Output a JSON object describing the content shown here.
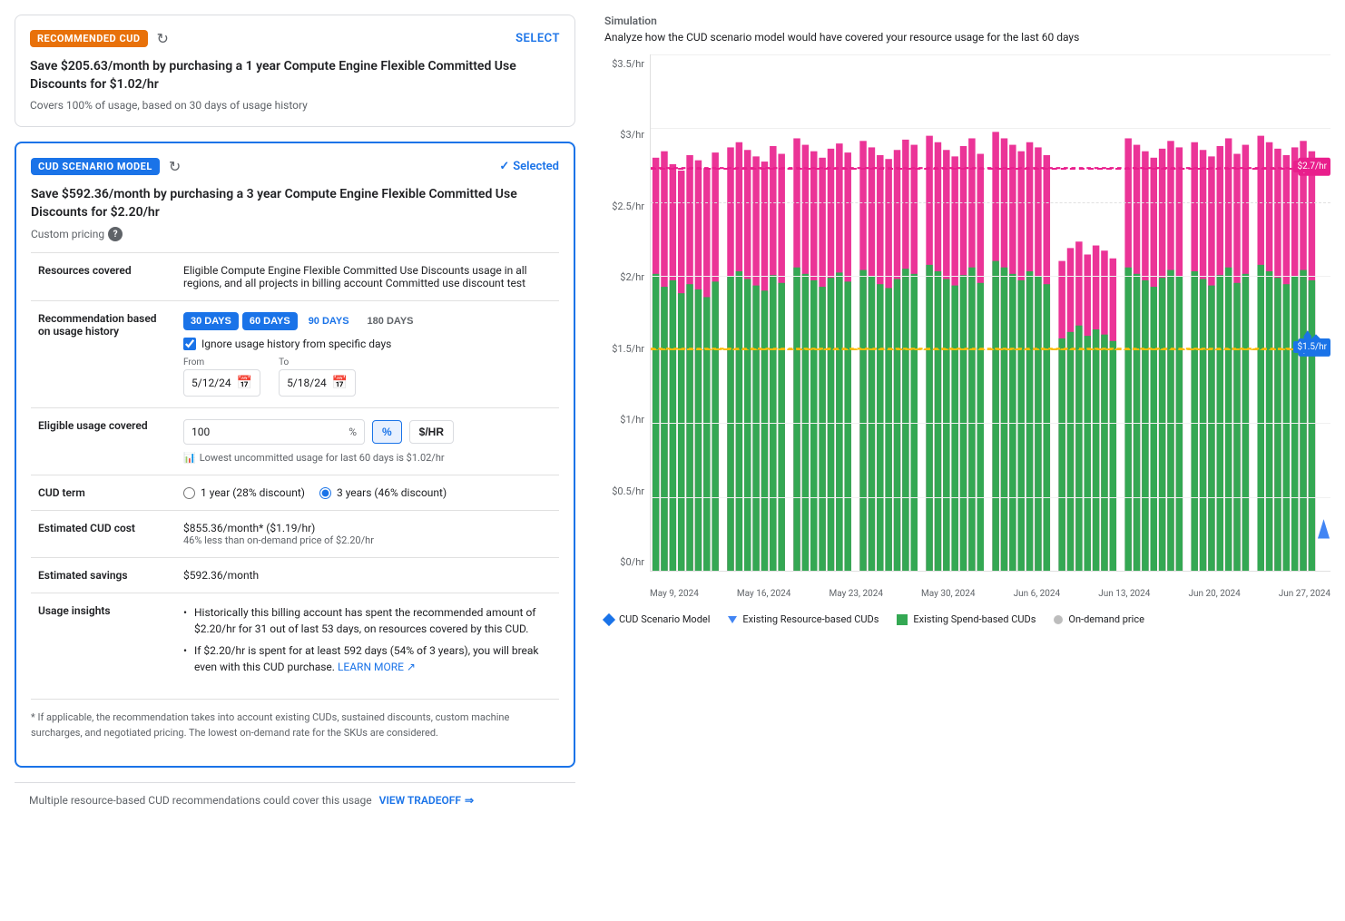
{
  "recommended": {
    "badge": "RECOMMENDED CUD",
    "select_label": "SELECT",
    "title": "Save $205.63/month by purchasing a 1 year Compute Engine Flexible Committed Use Discounts for $1.02/hr",
    "subtitle": "Covers 100% of usage, based on 30 days of usage history"
  },
  "scenario": {
    "badge": "CUD SCENARIO MODEL",
    "selected_label": "Selected",
    "title": "Save $592.36/month by purchasing a 3 year Compute Engine Flexible Committed Use Discounts for $2.20/hr",
    "custom_pricing_label": "Custom pricing",
    "resources_covered_label": "Resources covered",
    "resources_covered_value": "Eligible Compute Engine Flexible Committed Use Discounts usage in all regions, and all projects in billing account Committed use discount test",
    "recommendation_label": "Recommendation based on usage history",
    "day_buttons": [
      "30 DAYS",
      "60 DAYS",
      "90 DAYS",
      "180 DAYS"
    ],
    "active_day": 1,
    "ignore_checkbox_label": "Ignore usage history from specific days",
    "from_label": "From",
    "from_date": "5/12/24",
    "to_label": "To",
    "to_date": "5/18/24",
    "eligible_label": "Eligible usage covered",
    "coverage_value": "100",
    "pct_symbol": "%",
    "unit_pct": "%",
    "unit_hr": "$/HR",
    "lowest_usage_text": "Lowest uncommitted usage for last 60 days is $1.02/hr",
    "cud_term_label": "CUD term",
    "term_1yr": "1 year (28% discount)",
    "term_3yr": "3 years (46% discount)",
    "estimated_cost_label": "Estimated CUD cost",
    "estimated_cost_value": "$855.36/month* ($1.19/hr)",
    "estimated_cost_sub": "46% less than on-demand price of $2.20/hr",
    "estimated_savings_label": "Estimated savings",
    "estimated_savings_value": "$592.36/month",
    "usage_insights_label": "Usage insights",
    "insights": [
      "Historically this billing account has spent the recommended amount of $2.20/hr for 31 out of last 53 days, on resources covered by this CUD.",
      "If $2.20/hr is spent for at least 592 days (54% of 3 years), you will break even with this CUD purchase."
    ],
    "learn_more_label": "LEARN MORE",
    "footnote": "* If applicable, the recommendation takes into account existing CUDs, sustained discounts, custom machine surcharges, and negotiated pricing. The lowest on-demand rate for the SKUs are considered."
  },
  "bottom_bar": {
    "text": "Multiple resource-based CUD recommendations could cover this usage",
    "view_tradeoff_label": "VIEW TRADEOFF"
  },
  "simulation": {
    "title": "Simulation",
    "description": "Analyze how the CUD scenario model would have covered your resource usage for the last 60 days",
    "y_labels": [
      "$3.5/hr",
      "$3/hr",
      "$2.5/hr",
      "$2/hr",
      "$1.5/hr",
      "$1/hr",
      "$0.5/hr",
      "$0/hr"
    ],
    "x_labels": [
      "May 9, 2024",
      "May 16, 2024",
      "May 23, 2024",
      "May 30, 2024",
      "Jun 6, 2024",
      "Jun 13, 2024",
      "Jun 20, 2024",
      "Jun 27, 2024"
    ],
    "annotation_top": "$2.7/hr",
    "annotation_mid": "$1.5/hr",
    "legend": [
      {
        "label": "CUD Scenario Model",
        "type": "diamond",
        "color": "#1a73e8"
      },
      {
        "label": "Existing Resource-based CUDs",
        "type": "triangle",
        "color": "#4285f4"
      },
      {
        "label": "Existing Spend-based CUDs",
        "type": "square",
        "color": "#34a853"
      },
      {
        "label": "On-demand price",
        "type": "dot",
        "color": "#bdbdbd"
      }
    ]
  }
}
